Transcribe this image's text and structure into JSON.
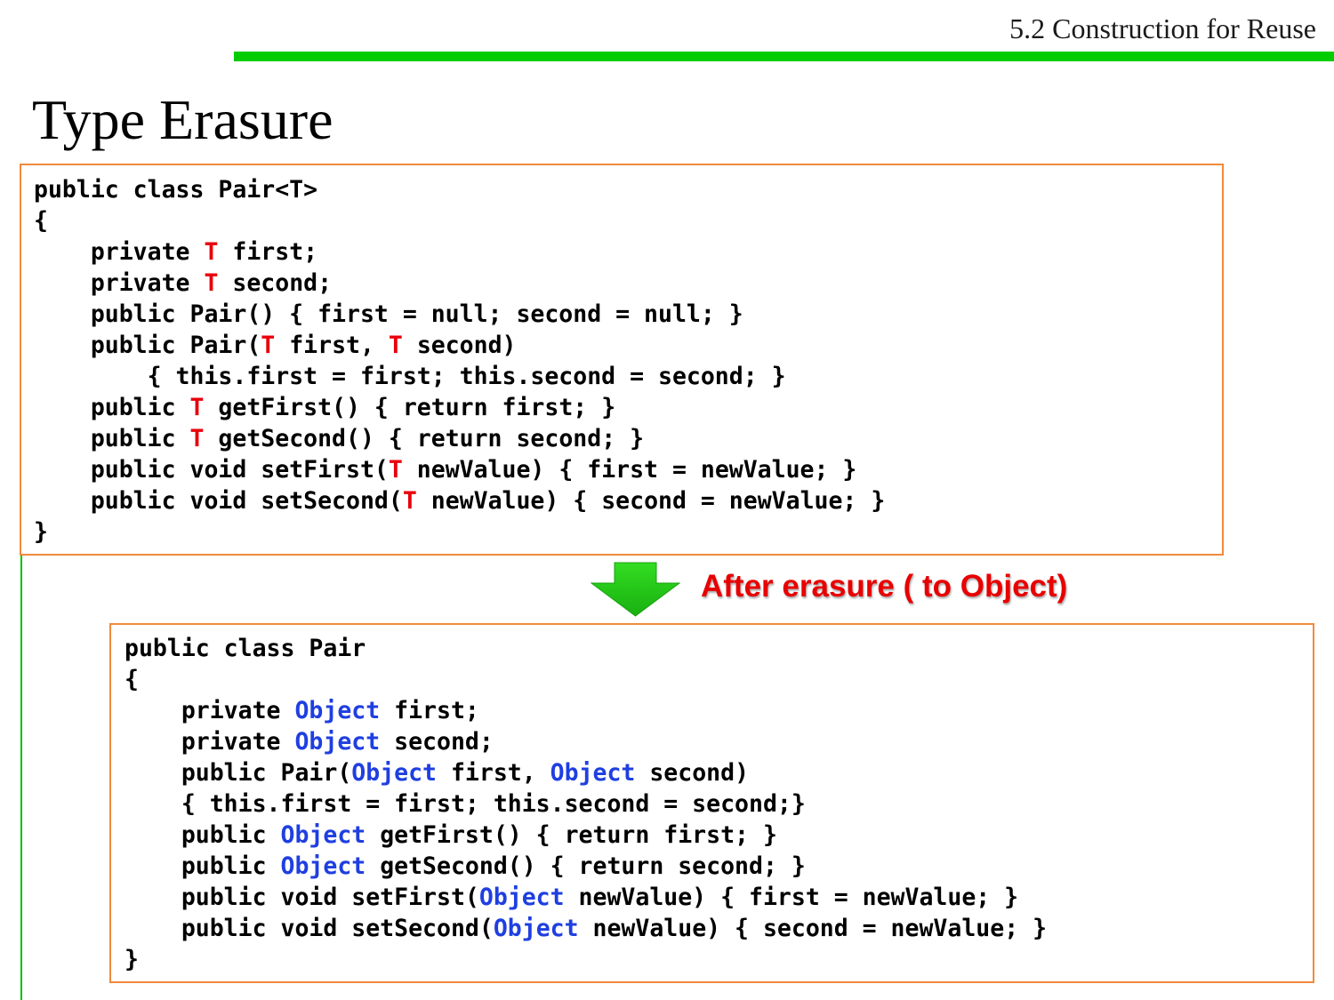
{
  "header": {
    "section": "5.2 Construction for Reuse"
  },
  "title": "Type Erasure",
  "colors": {
    "accent_bar": "#00cc00",
    "box_border": "#f08a3c",
    "type_param": "#e8000b",
    "erased_type": "#1f3fe0",
    "annotation": "#e80000"
  },
  "arrow": {
    "icon": "down-arrow-icon",
    "label": "After erasure ( to Object)"
  },
  "generic_code": {
    "highlight": "T",
    "lines": [
      "public class Pair<T>",
      "{",
      "    private T first;",
      "    private T second;",
      "    public Pair() { first = null; second = null; }",
      "    public Pair(T first, T second)",
      "        { this.first = first; this.second = second; }",
      "    public T getFirst() { return first; }",
      "    public T getSecond() { return second; }",
      "    public void setFirst(T newValue) { first = newValue; }",
      "    public void setSecond(T newValue) { second = newValue; }",
      "}"
    ]
  },
  "erased_code": {
    "highlight": "Object",
    "lines": [
      "public class Pair",
      "{",
      "    private Object first;",
      "    private Object second;",
      "    public Pair(Object first, Object second)",
      "    { this.first = first; this.second = second;}",
      "    public Object getFirst() { return first; }",
      "    public Object getSecond() { return second; }",
      "    public void setFirst(Object newValue) { first = newValue; }",
      "    public void setSecond(Object newValue) { second = newValue; }",
      "}"
    ]
  }
}
